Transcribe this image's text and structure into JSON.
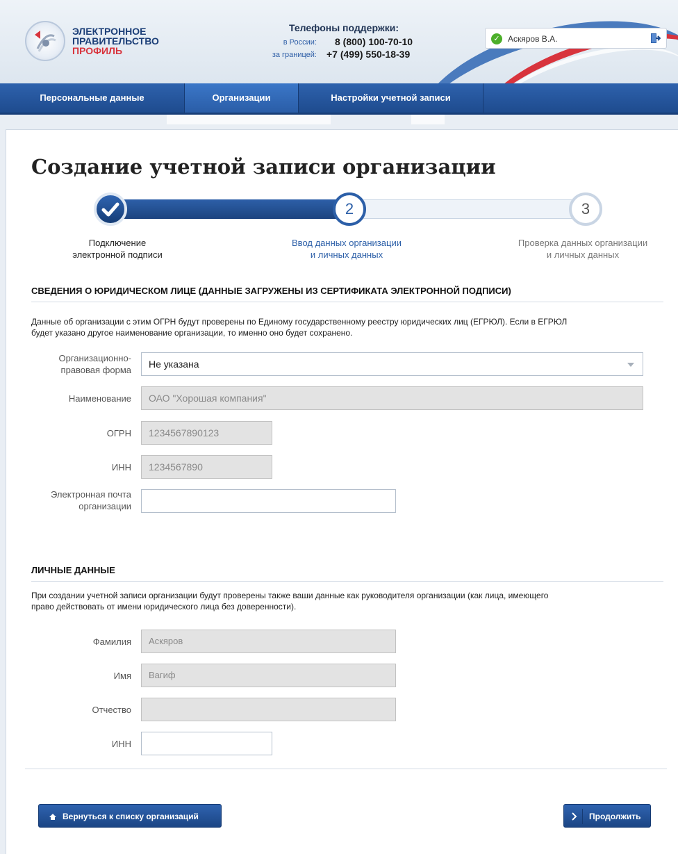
{
  "header": {
    "logo": {
      "line1": "ЭЛЕКТРОННОЕ",
      "line2": "ПРАВИТЕЛЬСТВО",
      "line3": "ПРОФИЛЬ"
    },
    "support": {
      "title": "Телефоны поддержки:",
      "russia_label": "в России:",
      "russia_phone": "8 (800) 100-70-10",
      "abroad_label": "за границей:",
      "abroad_phone": "+7 (499) 550-18-39"
    },
    "user": {
      "name": "Аскяров В.А."
    }
  },
  "nav": {
    "items": [
      {
        "label": "Персональные данные",
        "active": false
      },
      {
        "label": "Организации",
        "active": true
      },
      {
        "label": "Настройки учетной записи",
        "active": false
      }
    ]
  },
  "page": {
    "title": "Создание учетной записи организации"
  },
  "steps": [
    {
      "number": "",
      "label_line1": "Подключение",
      "label_line2": "электронной подписи",
      "status": "done"
    },
    {
      "number": "2",
      "label_line1": "Ввод данных организации",
      "label_line2": "и личных данных",
      "status": "current"
    },
    {
      "number": "3",
      "label_line1": "Проверка данных организации",
      "label_line2": "и личных данных",
      "status": "pending"
    }
  ],
  "legal_section": {
    "heading": "СВЕДЕНИЯ О ЮРИДИЧЕСКОМ ЛИЦЕ (ДАННЫЕ ЗАГРУЖЕНЫ ИЗ СЕРТИФИКАТА ЭЛЕКТРОННОЙ ПОДПИСИ)",
    "description_line1": "Данные об организации с этим ОГРН будут проверены по Единому государственному реестру юридических лиц (ЕГРЮЛ). Если в ЕГРЮЛ",
    "description_line2": "будет указано другое наименование организации, то именно оно будет сохранено.",
    "org_form": {
      "label_line1": "Организационно-",
      "label_line2": "правовая форма",
      "value": "Не указана"
    },
    "name": {
      "label": "Наименование",
      "value": "ОАО \"Хорошая компания\""
    },
    "ogrn": {
      "label": "ОГРН",
      "value": "1234567890123"
    },
    "inn": {
      "label": "ИНН",
      "value": "1234567890"
    },
    "email": {
      "label_line1": "Электронная почта",
      "label_line2": "организации",
      "value": ""
    }
  },
  "personal_section": {
    "heading": "ЛИЧНЫЕ ДАННЫЕ",
    "description_line1": "При создании учетной записи организации будут проверены также ваши данные как руководителя организации (как лица, имеющего",
    "description_line2": "право действовать от имени юридического лица без доверенности).",
    "surname": {
      "label": "Фамилия",
      "value": "Аскяров"
    },
    "first_name": {
      "label": "Имя",
      "value": "Вагиф"
    },
    "patronymic": {
      "label": "Отчество",
      "value": ""
    },
    "inn": {
      "label": "ИНН",
      "value": ""
    }
  },
  "buttons": {
    "back": "Вернуться к списку организаций",
    "next": "Продолжить"
  },
  "colors": {
    "brand_blue": "#1e4b8e",
    "accent_red": "#d8343d",
    "success_green": "#4caf2a"
  }
}
